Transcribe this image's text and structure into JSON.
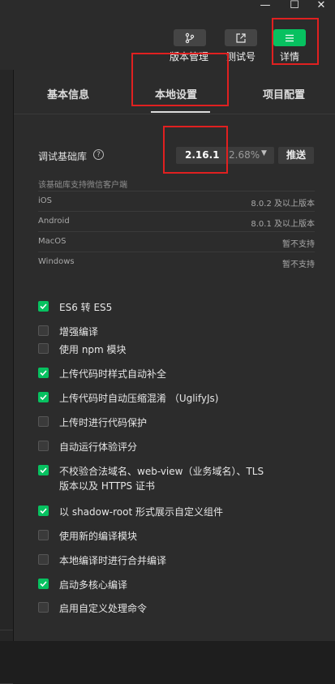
{
  "toolbar": {
    "buttons": [
      {
        "label": "版本管理",
        "icon": "branch-icon",
        "active": false
      },
      {
        "label": "测试号",
        "icon": "external-link-icon",
        "active": false
      },
      {
        "label": "详情",
        "icon": "menu-icon",
        "active": true
      }
    ]
  },
  "window_controls": {
    "minimize": "—",
    "maximize": "☐",
    "close": "✕"
  },
  "tabs": [
    {
      "label": "基本信息",
      "selected": false
    },
    {
      "label": "本地设置",
      "selected": true
    },
    {
      "label": "项目配置",
      "selected": false
    }
  ],
  "debug_lib": {
    "label": "调试基础库",
    "help": "?",
    "version": "2.16.1",
    "percent": "2.68%",
    "caret": "▼",
    "push_label": "推送",
    "support_note": "该基础库支持微信客户端",
    "rows": [
      {
        "os": "iOS",
        "value": "8.0.2 及以上版本"
      },
      {
        "os": "Android",
        "value": "8.0.1 及以上版本"
      },
      {
        "os": "MacOS",
        "value": "暂不支持"
      },
      {
        "os": "Windows",
        "value": "暂不支持"
      }
    ]
  },
  "options": [
    {
      "label": "ES6 转 ES5",
      "checked": true
    },
    {
      "label": "增强编译",
      "checked": false
    },
    {
      "label": "使用 npm 模块",
      "checked": false
    },
    {
      "label": "上传代码时样式自动补全",
      "checked": true
    },
    {
      "label": "上传代码时自动压缩混淆 （UglifyJs)",
      "checked": true
    },
    {
      "label": "上传时进行代码保护",
      "checked": false
    },
    {
      "label": "自动运行体验评分",
      "checked": false
    },
    {
      "label": "不校验合法域名、web-view（业务域名）、TLS",
      "label2": "版本以及 HTTPS 证书",
      "checked": true
    },
    {
      "label": "以 shadow-root 形式展示自定义组件",
      "checked": true
    },
    {
      "label": "使用新的编译模块",
      "checked": false
    },
    {
      "label": "本地编译时进行合并编译",
      "checked": false
    },
    {
      "label": "启动多核心编译",
      "checked": true
    },
    {
      "label": "启用自定义处理命令",
      "checked": false
    }
  ],
  "colors": {
    "accent": "#07c160",
    "panel": "#2c2c2c",
    "annotation": "#e02020"
  }
}
